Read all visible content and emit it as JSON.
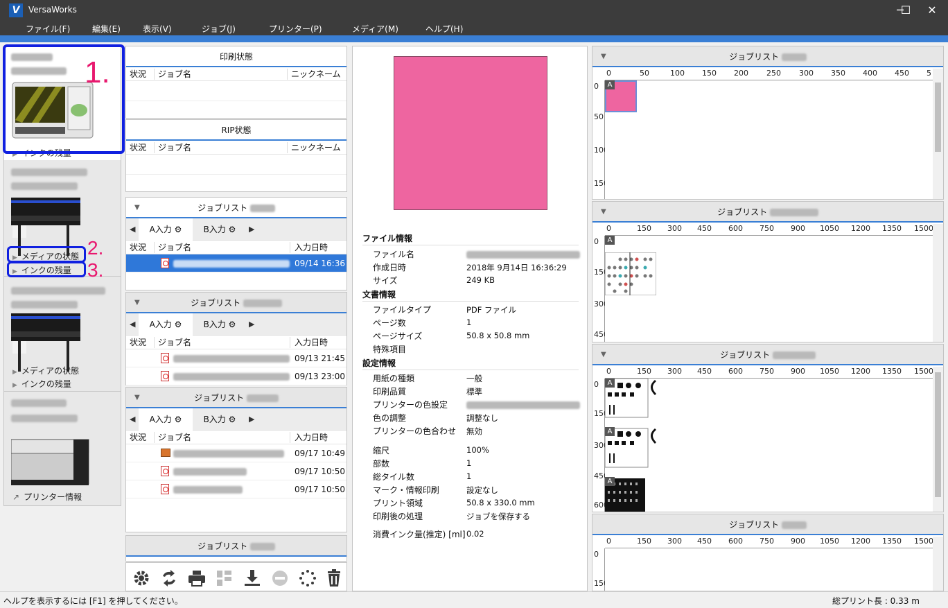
{
  "window": {
    "title": "VersaWorks",
    "minimize": "─",
    "maximize": "☐",
    "close": "✕"
  },
  "menu": [
    "ファイル(F)",
    "編集(E)",
    "表示(V)",
    "ジョブ(J)",
    "プリンター(P)",
    "メディア(M)",
    "ヘルプ(H)"
  ],
  "printers": {
    "p1": {
      "ink_label": "インクの残量"
    },
    "p2": {
      "media_label": "メディアの状態",
      "ink_label": "インクの残量"
    },
    "p3": {
      "media_label": "メディアの状態",
      "ink_label": "インクの残量"
    },
    "p4": {
      "info_label": "プリンター情報"
    }
  },
  "callouts": [
    "1.",
    "2.",
    "3."
  ],
  "print_status": {
    "title": "印刷状態",
    "columns": [
      "状況",
      "ジョブ名",
      "ニックネーム"
    ]
  },
  "rip_status": {
    "title": "RIP状態",
    "columns": [
      "状況",
      "ジョブ名",
      "ニックネーム"
    ]
  },
  "joblists": {
    "columns": [
      "状況",
      "ジョブ名",
      "入力日時"
    ],
    "tab_a": "A入力",
    "tab_b": "B入力",
    "list1": {
      "title": "ジョブリスト",
      "rows": [
        {
          "date": "09/14 16:36"
        }
      ]
    },
    "list2": {
      "title": "ジョブリスト",
      "rows": [
        {
          "date": "09/13 21:45"
        },
        {
          "date": "09/13 23:00"
        }
      ]
    },
    "list3": {
      "title": "ジョブリスト",
      "rows": [
        {
          "date": "09/17 10:49"
        },
        {
          "date": "09/17 10:50"
        },
        {
          "date": "09/17 10:50"
        }
      ]
    },
    "list4": {
      "title": "ジョブリスト"
    }
  },
  "toolbar": [
    "gear-icon",
    "refresh-icon",
    "print-icon",
    "layout-icon",
    "download-icon",
    "stop-icon",
    "spinner-icon",
    "trash-icon"
  ],
  "file_info": {
    "section_file": "ファイル情報",
    "file_name_label": "ファイル名",
    "created_label": "作成日時",
    "created_value": "2018年 9月14日 16:36:29",
    "size_label": "サイズ",
    "size_value": "249 KB",
    "section_doc": "文書情報",
    "filetype_label": "ファイルタイプ",
    "filetype_value": "PDF ファイル",
    "pages_label": "ページ数",
    "pages_value": "1",
    "pagesize_label": "ページサイズ",
    "pagesize_value": "50.8 x 50.8 mm",
    "special_label": "特殊項目",
    "section_settings": "設定情報",
    "paper_label": "用紙の種類",
    "paper_value": "一般",
    "quality_label": "印刷品質",
    "quality_value": "標準",
    "printer_color_label": "プリンターの色設定",
    "color_adj_label": "色の調整",
    "color_adj_value": "調整なし",
    "color_match_label": "プリンターの色合わせ",
    "color_match_value": "無効",
    "scale_label": "縮尺",
    "scale_value": "100%",
    "copies_label": "部数",
    "copies_value": "1",
    "tiles_label": "総タイル数",
    "tiles_value": "1",
    "marks_label": "マーク・情報印刷",
    "marks_value": "設定なし",
    "area_label": "プリント領域",
    "area_value": "50.8 x 330.0 mm",
    "after_label": "印刷後の処理",
    "after_value": "ジョブを保存する",
    "ink_label": "消費インク量(推定) [ml]",
    "ink_value": "0.02"
  },
  "right_lists": [
    {
      "title": "ジョブリスト",
      "ticks": [
        "0",
        "50",
        "100",
        "150",
        "200",
        "250",
        "300",
        "350",
        "400",
        "450",
        "5"
      ],
      "vticks": [
        "0",
        "50",
        "100",
        "150"
      ]
    },
    {
      "title": "ジョブリスト",
      "ticks": [
        "0",
        "150",
        "300",
        "450",
        "600",
        "750",
        "900",
        "1050",
        "1200",
        "1350",
        "1500"
      ],
      "vticks": [
        "0",
        "150",
        "300",
        "450"
      ]
    },
    {
      "title": "ジョブリスト",
      "ticks": [
        "0",
        "150",
        "300",
        "450",
        "600",
        "750",
        "900",
        "1050",
        "1200",
        "1350",
        "1500"
      ],
      "vticks": [
        "0",
        "150",
        "300",
        "450",
        "600"
      ]
    },
    {
      "title": "ジョブリスト",
      "ticks": [
        "0",
        "150",
        "300",
        "450",
        "600",
        "750",
        "900",
        "1050",
        "1200",
        "1350",
        "1500"
      ],
      "vticks": [
        "0",
        "150"
      ]
    }
  ],
  "tag_a": "A",
  "status": {
    "help": "ヘルプを表示するには [F1] を押してください。",
    "total": "総プリント長 : 0.33 m"
  },
  "colors": {
    "accent": "#3a7fd5",
    "selection": "#2f78d9",
    "swatch": "#ee65a0",
    "highlight": "#1020e0",
    "callout": "#e8186e"
  }
}
